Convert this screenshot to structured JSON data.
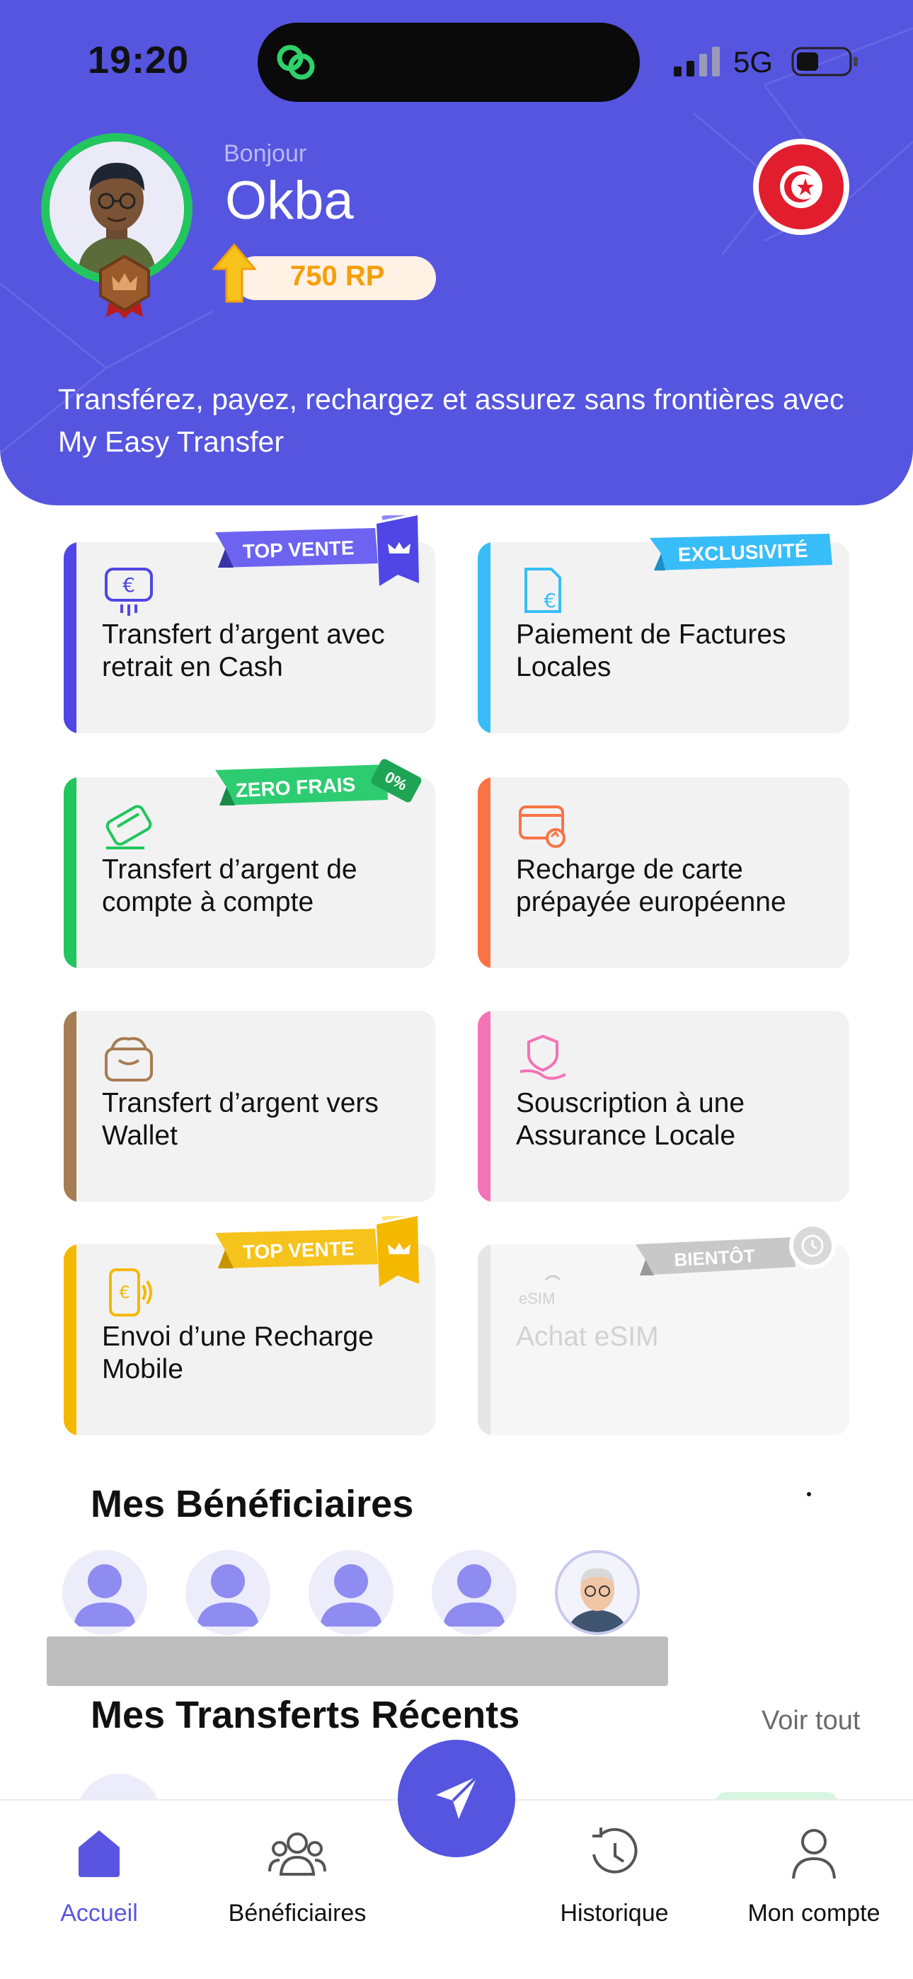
{
  "status_bar": {
    "time": "19:20",
    "network": "5G"
  },
  "header": {
    "greeting": "Bonjour",
    "name": "Okba",
    "reward_points": "750 RP",
    "tagline": "Transférez, payez, rechargez et assurez sans frontières avec My Easy Transfer"
  },
  "services": [
    {
      "label": "Transfert d’argent avec retrait en Cash",
      "ribbon": "TOP VENTE",
      "accent": "#4f46e5",
      "icon": "euro-wallet-icon"
    },
    {
      "label": "Paiement de Factures Locales",
      "ribbon": "EXCLUSIVITÉ",
      "accent": "#38bdf8",
      "icon": "euro-bill-icon"
    },
    {
      "label": "Transfert d’argent de compte à compte",
      "ribbon": "ZERO FRAIS",
      "ribbon_tag": "0%",
      "accent": "#22c55e",
      "icon": "card-icon"
    },
    {
      "label": "Recharge de carte prépayée européenne",
      "ribbon": "",
      "accent": "#f97345",
      "icon": "card-refresh-icon"
    },
    {
      "label": "Transfert d’argent vers Wallet",
      "ribbon": "",
      "accent": "#a67c52",
      "icon": "wallet-icon"
    },
    {
      "label": "Souscription à une Assurance Locale",
      "ribbon": "",
      "accent": "#f472b6",
      "icon": "insurance-hand-icon"
    },
    {
      "label": "Envoi d’une Recharge Mobile",
      "ribbon": "TOP VENTE",
      "accent": "#f5b800",
      "icon": "mobile-euro-icon"
    },
    {
      "label": "Achat eSIM",
      "ribbon": "BIENTÔT",
      "accent": "#e6e6e6",
      "icon": "esim-icon",
      "disabled": true
    }
  ],
  "beneficiaries": {
    "title": "Mes Bénéficiaires"
  },
  "recent_transfers": {
    "title": "Mes Transferts Récents",
    "see_all": "Voir tout"
  },
  "tabbar": {
    "items": [
      {
        "label": "Accueil",
        "active": true
      },
      {
        "label": "Bénéficiaires",
        "active": false
      },
      {
        "label": "Historique",
        "active": false
      },
      {
        "label": "Mon compte",
        "active": false
      }
    ]
  },
  "colors": {
    "primary": "#5555e0",
    "avatar_ring": "#22c55e",
    "rp_text": "#f59e0b"
  }
}
